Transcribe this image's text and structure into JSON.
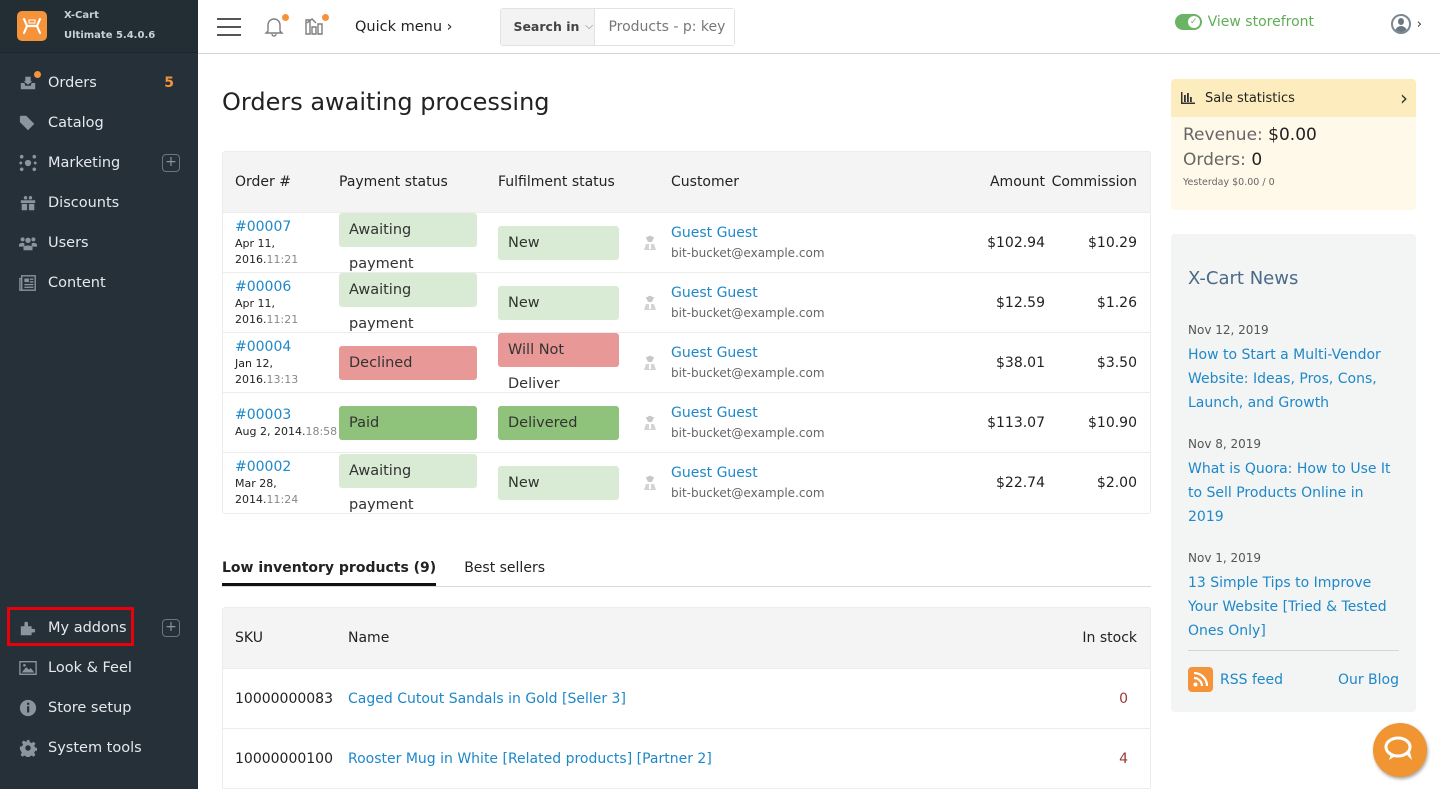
{
  "brand": {
    "name": "X-Cart",
    "edition": "Ultimate 5.4.0.6",
    "accent": "#f5933b"
  },
  "sidebar": {
    "items": [
      {
        "label": "Orders",
        "icon": "orders-icon",
        "badge": "5",
        "dot": true
      },
      {
        "label": "Catalog",
        "icon": "tag-icon"
      },
      {
        "label": "Marketing",
        "icon": "network-icon",
        "plus": true
      },
      {
        "label": "Discounts",
        "icon": "gift-icon"
      },
      {
        "label": "Users",
        "icon": "users-icon"
      },
      {
        "label": "Content",
        "icon": "content-icon"
      }
    ],
    "bottom_items": [
      {
        "label": "My addons",
        "icon": "puzzle-icon",
        "plus": true,
        "highlighted": true
      },
      {
        "label": "Look & Feel",
        "icon": "image-icon"
      },
      {
        "label": "Store setup",
        "icon": "info-icon"
      },
      {
        "label": "System tools",
        "icon": "gear-icon"
      }
    ]
  },
  "topbar": {
    "quick_menu": "Quick menu ›",
    "search_in_label": "Search in",
    "search_placeholder": "Products - p: key",
    "view_storefront": "View storefront",
    "storefront_color": "#5fae57"
  },
  "orders": {
    "title": "Orders awaiting processing",
    "columns": [
      "Order #",
      "Payment status",
      "Fulfilment status",
      "Customer",
      "Amount",
      "Commission"
    ],
    "rows": [
      {
        "number": "#00007",
        "date": "Apr 11, 2016.",
        "time": "11:21",
        "payment": "Awaiting payment",
        "payment_kind": "new",
        "fulfilment": "New",
        "fulfilment_kind": "new",
        "customer": "Guest Guest",
        "email": "bit-bucket@example.com",
        "amount": "$102.94",
        "commission": "$10.29"
      },
      {
        "number": "#00006",
        "date": "Apr 11, 2016.",
        "time": "11:21",
        "payment": "Awaiting payment",
        "payment_kind": "new",
        "fulfilment": "New",
        "fulfilment_kind": "new",
        "customer": "Guest Guest",
        "email": "bit-bucket@example.com",
        "amount": "$12.59",
        "commission": "$1.26"
      },
      {
        "number": "#00004",
        "date": "Jan 12, 2016.",
        "time": "13:13",
        "payment": "Declined",
        "payment_kind": "bad",
        "fulfilment": "Will Not Deliver",
        "fulfilment_kind": "bad",
        "customer": "Guest Guest",
        "email": "bit-bucket@example.com",
        "amount": "$38.01",
        "commission": "$3.50"
      },
      {
        "number": "#00003",
        "date": "Aug 2, 2014.",
        "time": "18:58",
        "payment": "Paid",
        "payment_kind": "good",
        "fulfilment": "Delivered",
        "fulfilment_kind": "good",
        "customer": "Guest Guest",
        "email": "bit-bucket@example.com",
        "amount": "$113.07",
        "commission": "$10.90"
      },
      {
        "number": "#00002",
        "date": "Mar 28, 2014.",
        "time": "11:24",
        "payment": "Awaiting payment",
        "payment_kind": "new",
        "fulfilment": "New",
        "fulfilment_kind": "new",
        "customer": "Guest Guest",
        "email": "bit-bucket@example.com",
        "amount": "$22.74",
        "commission": "$2.00"
      }
    ],
    "status_colors": {
      "new": "#d9ebd4",
      "bad": "#e89896",
      "good": "#8fc27b"
    }
  },
  "inventory": {
    "tabs": [
      {
        "label": "Low inventory products (9)",
        "active": true
      },
      {
        "label": "Best sellers",
        "active": false
      }
    ],
    "columns": [
      "SKU",
      "Name",
      "In stock"
    ],
    "rows": [
      {
        "sku": "10000000083",
        "name": "Caged Cutout Sandals in Gold [Seller 3]",
        "stock": "0"
      },
      {
        "sku": "10000000100",
        "name": "Rooster Mug in White [Related products] [Partner 2]",
        "stock": "4"
      }
    ]
  },
  "sale_statistics": {
    "title": "Sale statistics",
    "revenue_label": "Revenue:",
    "revenue_value": "$0.00",
    "orders_label": "Orders:",
    "orders_value": "0",
    "yesterday": "Yesterday $0.00 / 0"
  },
  "news": {
    "title": "X-Cart News",
    "items": [
      {
        "date": "Nov 12, 2019",
        "title": "How to Start a Multi-Vendor Website: Ideas, Pros, Cons, Launch, and Growth"
      },
      {
        "date": "Nov 8, 2019",
        "title": "What is Quora: How to Use It to Sell Products Online in 2019"
      },
      {
        "date": "Nov 1, 2019",
        "title": "13 Simple Tips to Improve Your Website [Tried & Tested Ones Only]"
      }
    ],
    "rss_label": "RSS feed",
    "blog_label": "Our Blog"
  }
}
